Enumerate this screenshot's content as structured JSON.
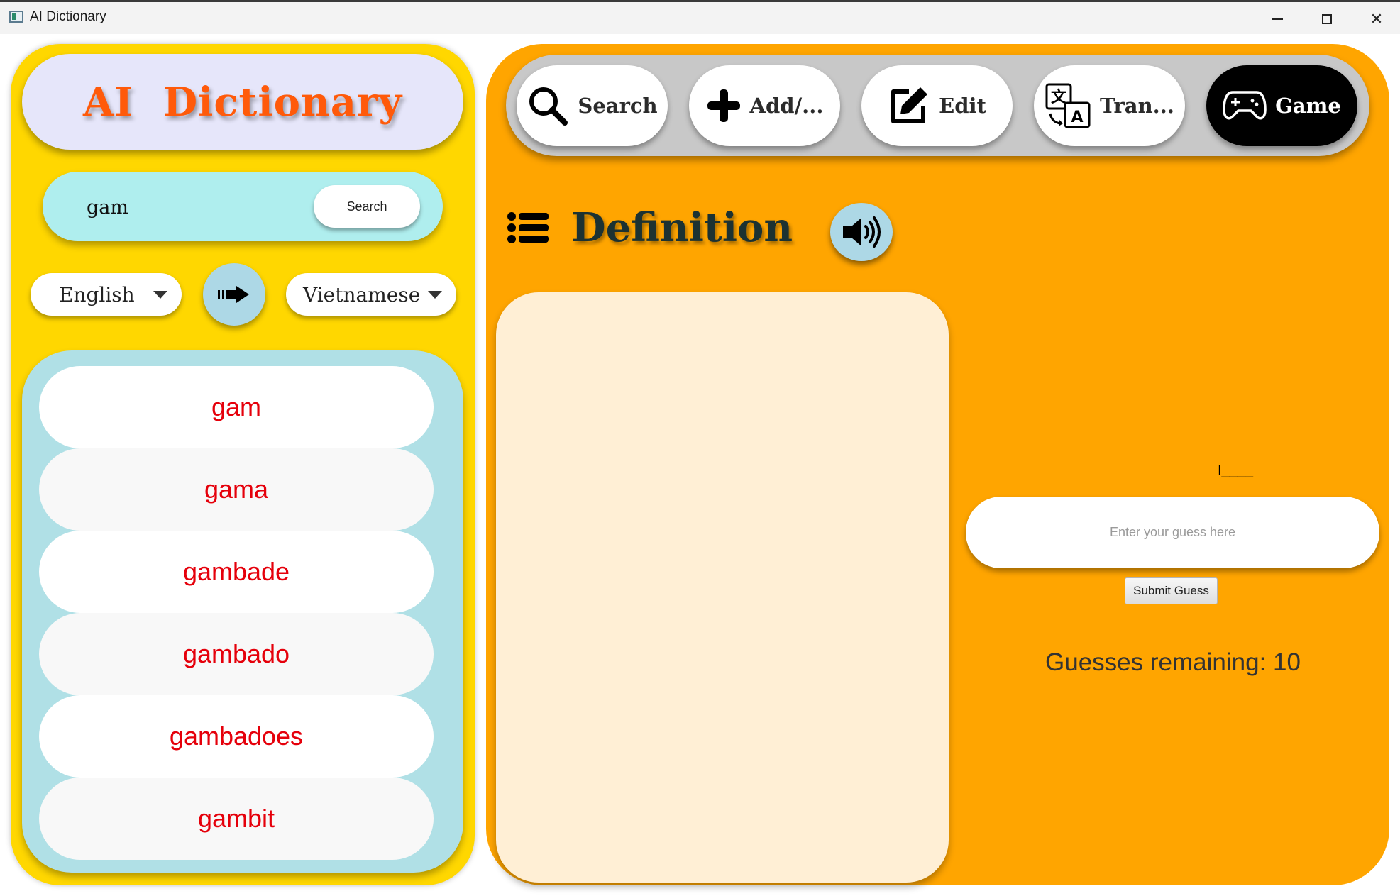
{
  "window": {
    "title": "AI Dictionary",
    "controls": [
      "minimize-icon",
      "maximize-icon",
      "close-icon"
    ]
  },
  "sidebar": {
    "brand_title": "AI  Dictionary",
    "search": {
      "input_value": "gam",
      "button_label": "Search"
    },
    "language": {
      "source": "English",
      "target": "Vietnamese",
      "swap_icon": "arrow-right-icon"
    },
    "suggestions": [
      "gam",
      "gama",
      "gambade",
      "gambado",
      "gambadoes",
      "gambit"
    ]
  },
  "navigation": {
    "tabs": [
      {
        "label": "Search",
        "icon": "search-icon"
      },
      {
        "label": "Add/...",
        "icon": "plus-icon"
      },
      {
        "label": "Edit",
        "icon": "edit-icon"
      },
      {
        "label": "Tran...",
        "icon": "translate-icon"
      },
      {
        "label": "Game",
        "icon": "gamepad-icon"
      }
    ],
    "active_tab": "Game"
  },
  "definition": {
    "title": "Definition",
    "list_icon": "list-icon",
    "speaker_icon": "speaker-icon",
    "content": ""
  },
  "game": {
    "masked_word": "I____",
    "guess_placeholder": "Enter your guess here",
    "guess_value": "",
    "submit_label": "Submit Guess",
    "guesses_remaining_text": "Guesses remaining: 10"
  },
  "colors": {
    "sidebar_bg": "#ffd700",
    "main_bg": "#ffa500",
    "brand_text": "#ff5a0a",
    "suggestion_text": "#e5000b",
    "search_box": "#afeeee",
    "word_list_bg": "#b0e0e6",
    "definition_box": "#ffefd5"
  }
}
